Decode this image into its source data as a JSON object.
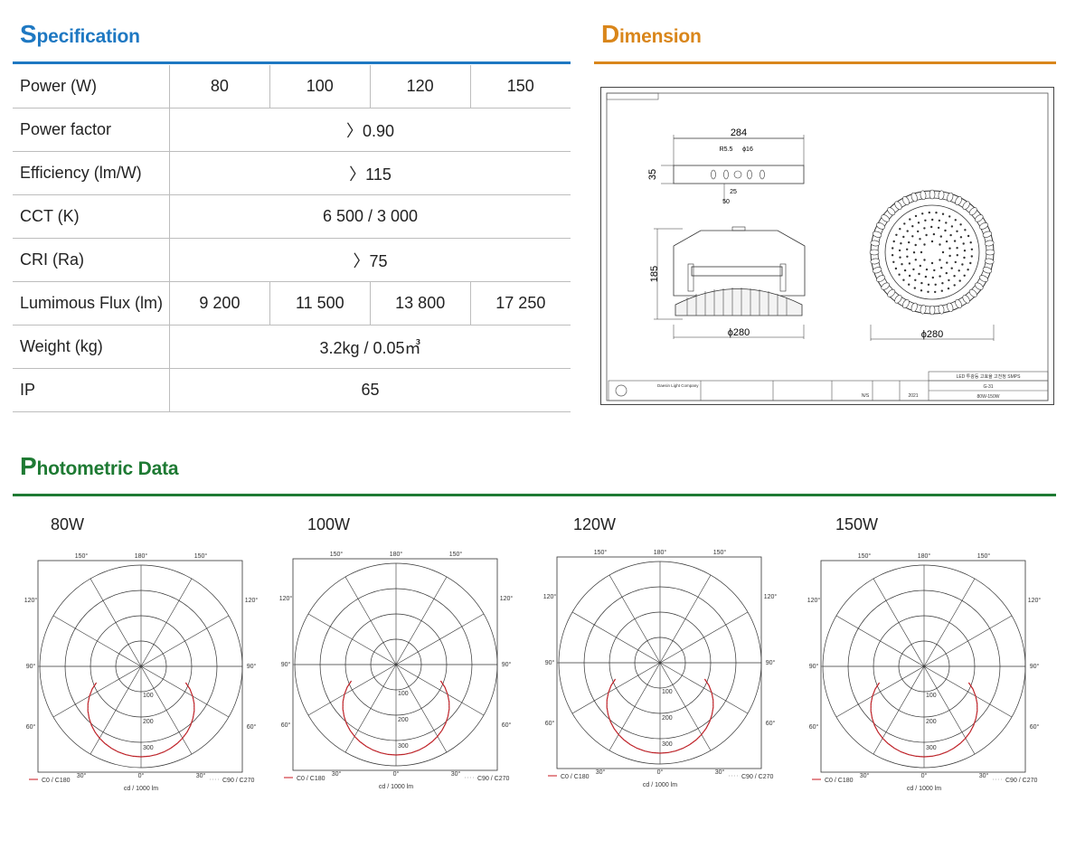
{
  "sections": {
    "spec": {
      "first": "S",
      "rest": "pecification",
      "color": "#1e78c2"
    },
    "dim": {
      "first": "D",
      "rest": "imension",
      "color": "#d9861b"
    },
    "photo": {
      "first": "P",
      "rest": "hotometric Data",
      "color": "#1e7a33"
    }
  },
  "spec_table": {
    "rows": [
      {
        "label": "Power (W)",
        "values": [
          "80",
          "100",
          "120",
          "150"
        ]
      },
      {
        "label": "Power factor",
        "values": [
          "〉0.90"
        ]
      },
      {
        "label": "Efficiency (lm/W)",
        "values": [
          "〉115"
        ]
      },
      {
        "label": "CCT (K)",
        "values": [
          "6 500 / 3 000"
        ]
      },
      {
        "label": "CRI (Ra)",
        "values": [
          "〉75"
        ]
      },
      {
        "label": "Lumimous Flux (lm)",
        "values": [
          "9 200",
          "11 500",
          "13 800",
          "17 250"
        ]
      },
      {
        "label": "Weight (kg)",
        "values": [
          "3.2kg / 0.05㎥"
        ]
      },
      {
        "label": "IP",
        "values": [
          "65"
        ]
      }
    ]
  },
  "dimension": {
    "width": "284",
    "r": "R5.5",
    "hole": "ϕ16",
    "height_small": "35",
    "offset1": "25",
    "offset2": "50",
    "height": "185",
    "dia_side": "ϕ280",
    "dia_top": "ϕ280",
    "title_block": {
      "product": "LED 투광등 고효율 고천정 SMPS",
      "code": "G-31",
      "range": "80W-150W",
      "year": "2021",
      "scale": "N/S",
      "company": "Daesin Light Company"
    }
  },
  "photometric": {
    "charts": [
      {
        "title": "80W"
      },
      {
        "title": "100W"
      },
      {
        "title": "120W"
      },
      {
        "title": "150W"
      }
    ],
    "angle_labels": {
      "top": "180°",
      "upper": "150°",
      "upper_mid": "120°",
      "mid": "90°",
      "lower_mid": "60°",
      "lower": "30°",
      "bottom": "0°"
    },
    "radial_labels": [
      "100",
      "200",
      "300"
    ],
    "legend_c0": "C0 / C180",
    "legend_c90": "C90 / C270",
    "unit": "cd / 1000 lm",
    "curve_color": "#c8161d"
  }
}
